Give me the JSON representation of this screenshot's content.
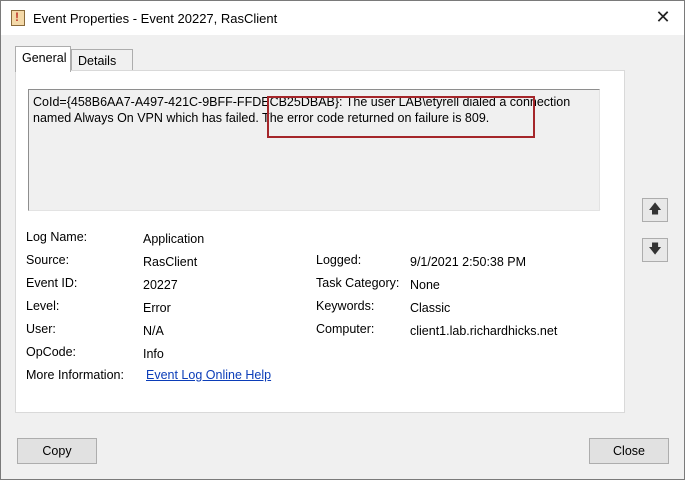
{
  "window": {
    "title": "Event Properties - Event 20227, RasClient",
    "close_glyph": "✕"
  },
  "tabs": [
    {
      "label": "General",
      "active": true
    },
    {
      "label": "Details",
      "active": false
    }
  ],
  "description": {
    "line1": "CoId={458B6AA7-A497-421C-9BFF-FFDECB25DBAB}: The user LAB\\etyrell dialed a connection",
    "line2": "named Always On VPN which has failed. The error code returned on failure is 809."
  },
  "fields": {
    "log_name": {
      "label": "Log Name:",
      "value": "Application"
    },
    "source": {
      "label": "Source:",
      "value": "RasClient"
    },
    "event_id": {
      "label": "Event ID:",
      "value": "20227"
    },
    "level": {
      "label": "Level:",
      "value": "Error"
    },
    "user": {
      "label": "User:",
      "value": "N/A"
    },
    "opcode": {
      "label": "OpCode:",
      "value": "Info"
    },
    "more_info": {
      "label": "More Information:",
      "value": "Event Log Online Help"
    },
    "logged": {
      "label": "Logged:",
      "value": "9/1/2021 2:50:38 PM"
    },
    "task_category": {
      "label": "Task Category:",
      "value": "None"
    },
    "keywords": {
      "label": "Keywords:",
      "value": "Classic"
    },
    "computer": {
      "label": "Computer:",
      "value": "client1.lab.richardhicks.net"
    }
  },
  "nav": {
    "up_glyph": "🡅",
    "down_glyph": "🡇"
  },
  "buttons": {
    "copy": "Copy",
    "close": "Close"
  },
  "colors": {
    "highlight": "#a5262a",
    "link": "#0b3db8"
  }
}
